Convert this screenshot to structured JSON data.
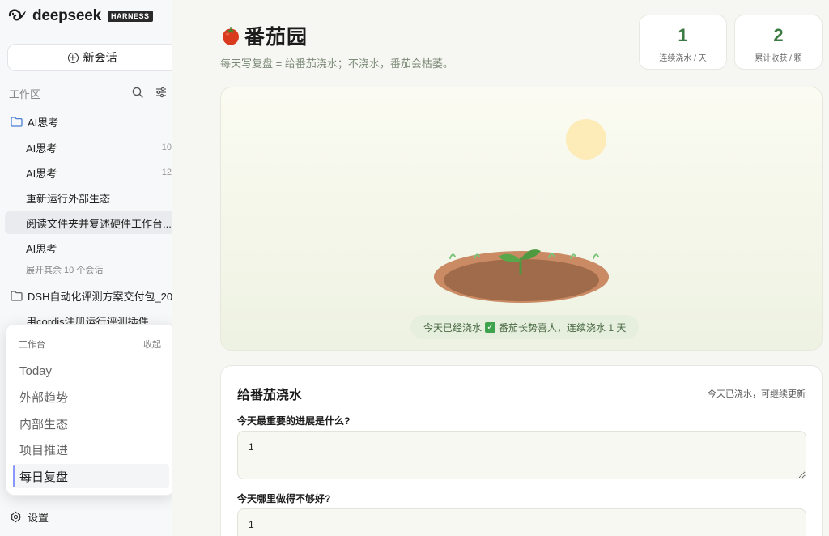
{
  "brand": {
    "name": "deepseek",
    "badge": "HARNESS"
  },
  "sidebar": {
    "new_chat_label": "新会话",
    "workspace_label": "工作区",
    "folders": [
      {
        "label": "AI思考",
        "sessions": [
          {
            "label": "AI思考",
            "count": "10"
          },
          {
            "label": "AI思考",
            "count": "12"
          },
          {
            "label": "重新运行外部生态",
            "count": ""
          },
          {
            "label": "阅读文件夹并复述硬件工作台...",
            "count": ""
          },
          {
            "label": "AI思考",
            "count": ""
          }
        ],
        "more_label": "展开其余 10 个会话"
      },
      {
        "label": "DSH自动化评测方案交付包_20",
        "sessions": [
          {
            "label": "用cordis注册运行评测插件",
            "count": ""
          }
        ]
      }
    ],
    "settings_label": "设置"
  },
  "workbench": {
    "title": "工作台",
    "collapse_label": "收起",
    "items": [
      "Today",
      "外部趋势",
      "内部生态",
      "项目推进",
      "每日复盘"
    ],
    "active_index": 4
  },
  "main": {
    "title": "番茄园",
    "subtitle": "每天写复盘 = 给番茄浇水；不浇水，番茄会枯萎。",
    "stats": [
      {
        "value": "1",
        "label": "连续浇水 / 天"
      },
      {
        "value": "2",
        "label": "累计收获 / 颗"
      }
    ],
    "garden_status": {
      "prefix": "今天已经浇水",
      "suffix": "番茄长势喜人，连续浇水 1 天"
    },
    "water_card": {
      "title": "给番茄浇水",
      "note": "今天已浇水，可继续更新",
      "questions": [
        {
          "label": "今天最重要的进展是什么?",
          "answer": "1"
        },
        {
          "label": "今天哪里做得不够好?",
          "answer": "1"
        }
      ]
    }
  },
  "colors": {
    "accent_green": "#3c7a44",
    "active_indicator": "#8a97ff",
    "soil": "#a06b4a"
  }
}
